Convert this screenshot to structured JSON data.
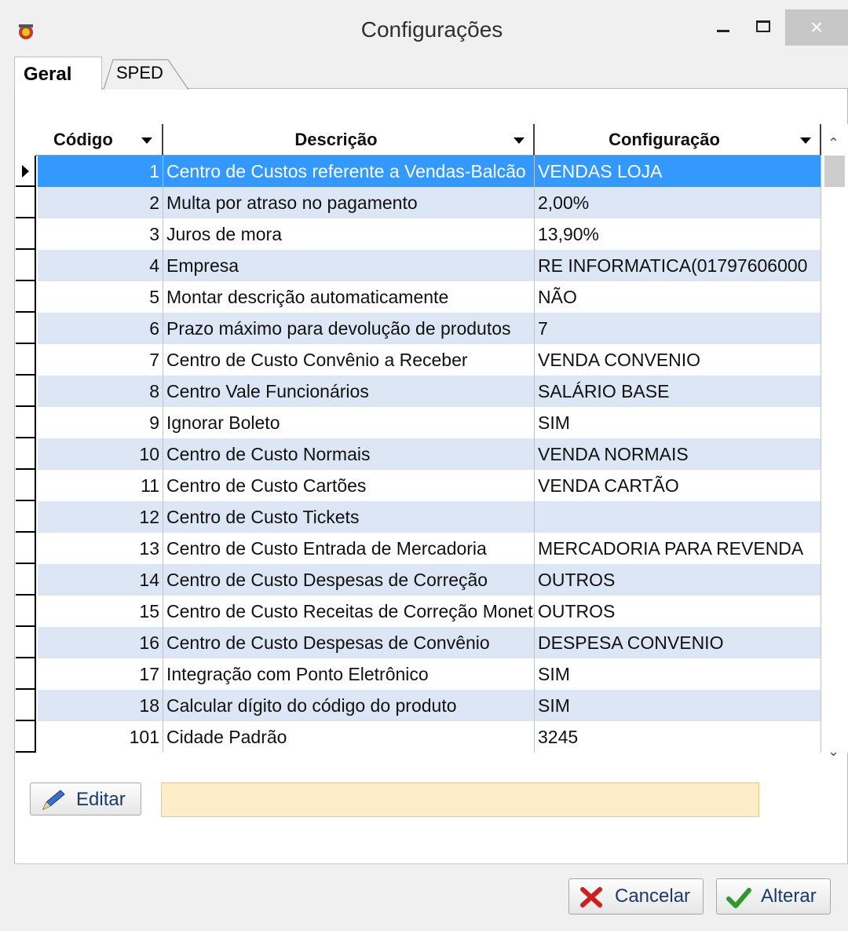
{
  "window": {
    "title": "Configurações",
    "close_glyph": "×"
  },
  "tabs": [
    {
      "label": "Geral",
      "active": true
    },
    {
      "label": "SPED",
      "active": false
    }
  ],
  "grid": {
    "columns": [
      "Código",
      "Descrição",
      "Configuração"
    ],
    "rows": [
      {
        "code": "1",
        "desc": "Centro de Custos referente a Vendas-Balcão",
        "conf": "VENDAS LOJA",
        "selected": true
      },
      {
        "code": "2",
        "desc": "Multa por atraso no pagamento",
        "conf": "2,00%"
      },
      {
        "code": "3",
        "desc": "Juros de mora",
        "conf": "13,90%"
      },
      {
        "code": "4",
        "desc": "Empresa",
        "conf": "RE INFORMATICA(01797606000"
      },
      {
        "code": "5",
        "desc": "Montar descrição automaticamente",
        "conf": "NÃO"
      },
      {
        "code": "6",
        "desc": "Prazo máximo para devolução de produtos",
        "conf": "7"
      },
      {
        "code": "7",
        "desc": "Centro de Custo Convênio a Receber",
        "conf": "VENDA CONVENIO"
      },
      {
        "code": "8",
        "desc": "Centro Vale Funcionários",
        "conf": "SALÁRIO BASE"
      },
      {
        "code": "9",
        "desc": "Ignorar Boleto",
        "conf": "SIM"
      },
      {
        "code": "10",
        "desc": "Centro de Custo Normais",
        "conf": "VENDA NORMAIS"
      },
      {
        "code": "11",
        "desc": "Centro de Custo Cartões",
        "conf": "VENDA CARTÃO"
      },
      {
        "code": "12",
        "desc": "Centro de Custo Tickets",
        "conf": ""
      },
      {
        "code": "13",
        "desc": "Centro de Custo Entrada de Mercadoria",
        "conf": "MERCADORIA PARA REVENDA"
      },
      {
        "code": "14",
        "desc": "Centro de Custo Despesas de Correção",
        "conf": "OUTROS"
      },
      {
        "code": "15",
        "desc": "Centro de Custo Receitas de Correção Monetária",
        "conf": "OUTROS"
      },
      {
        "code": "16",
        "desc": "Centro de Custo Despesas de Convênio",
        "conf": "DESPESA CONVENIO"
      },
      {
        "code": "17",
        "desc": "Integração com Ponto Eletrônico",
        "conf": "SIM"
      },
      {
        "code": "18",
        "desc": "Calcular dígito do código do produto",
        "conf": "SIM"
      },
      {
        "code": "101",
        "desc": "Cidade Padrão",
        "conf": "3245"
      }
    ]
  },
  "edit": {
    "button_label": "Editar",
    "field_value": ""
  },
  "footer": {
    "cancel_label": "Cancelar",
    "alter_label": "Alterar"
  },
  "colors": {
    "selection": "#3399ff",
    "row_alt": "#dce6f4",
    "edit_field": "#fdeec9",
    "cancel_icon": "#cc1f1f",
    "alter_icon": "#2e9a2e"
  }
}
